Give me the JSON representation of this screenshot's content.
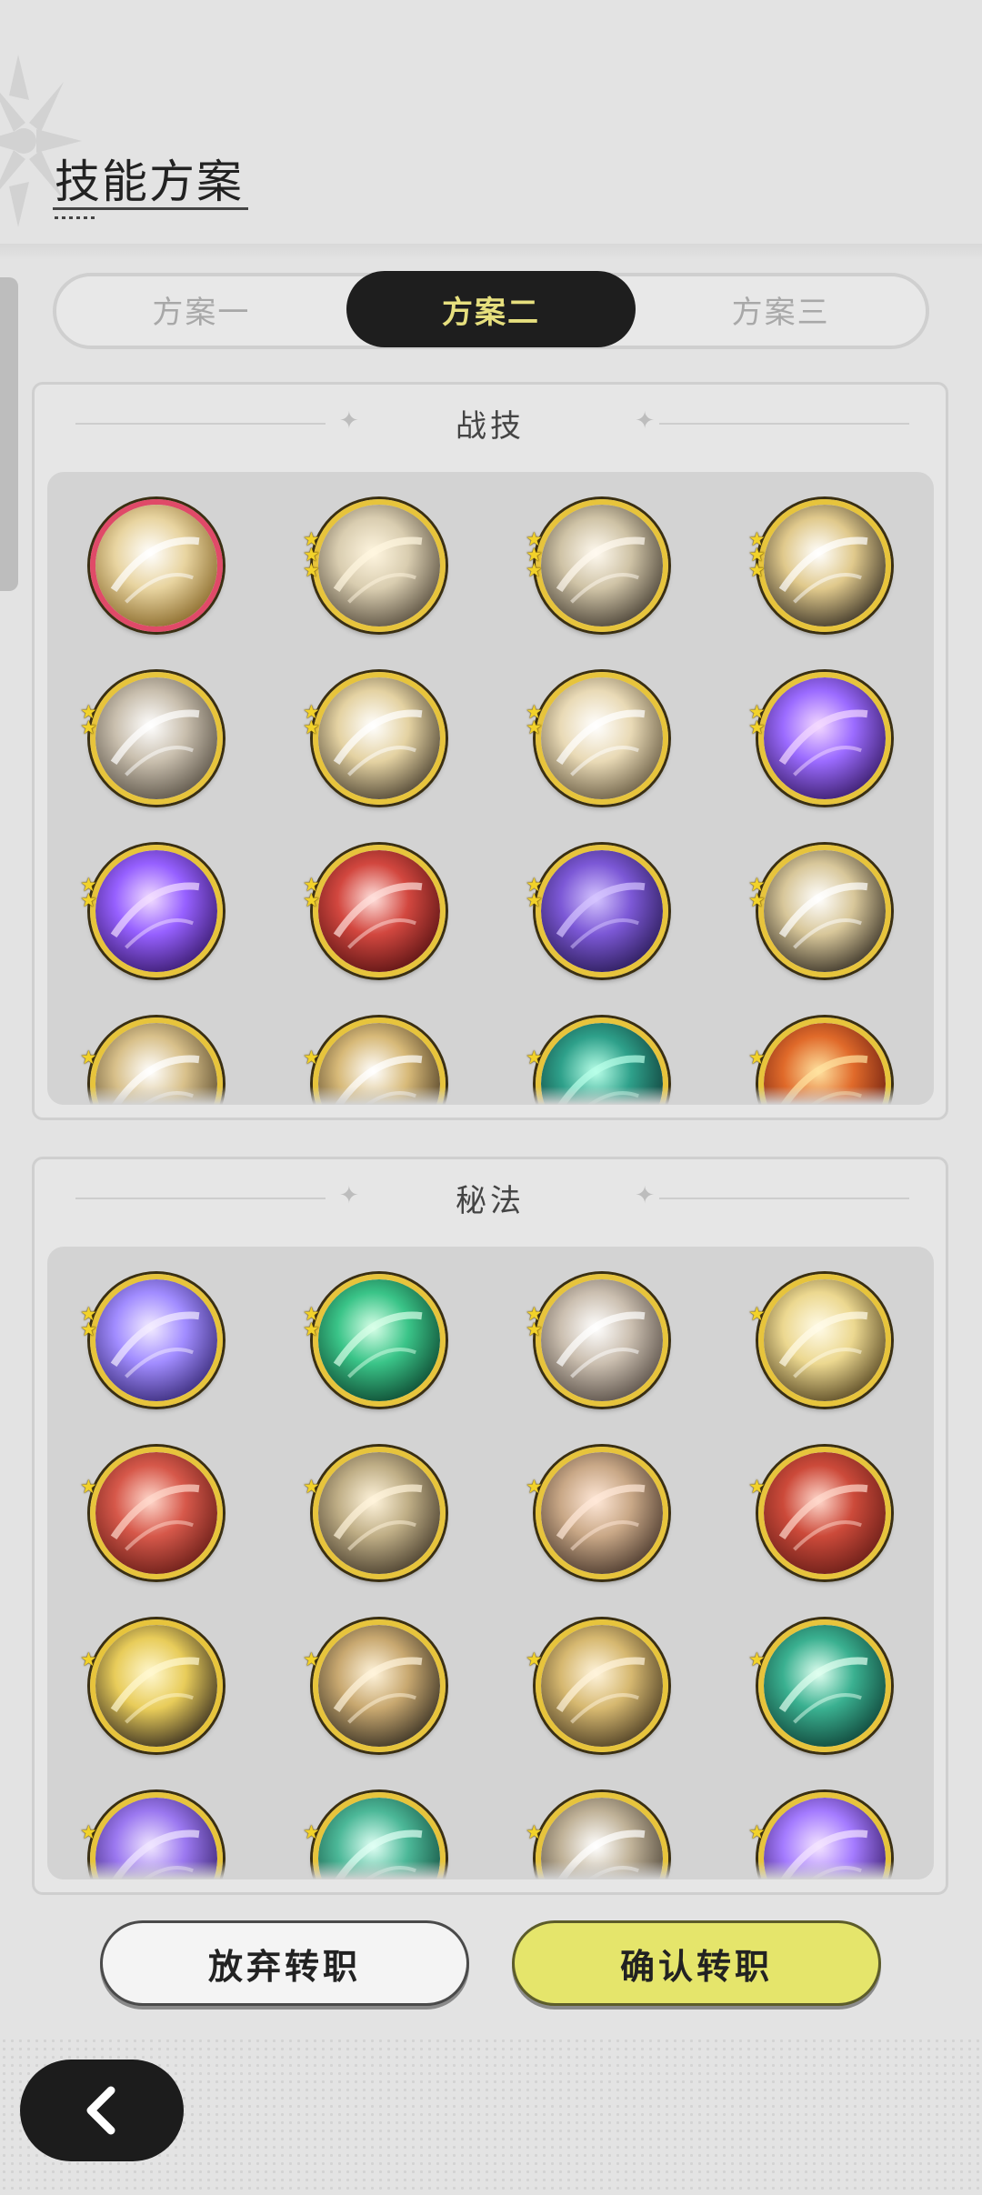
{
  "header": {
    "title": "技能方案"
  },
  "tabs": [
    {
      "label": "方案一",
      "active": false
    },
    {
      "label": "方案二",
      "active": true
    },
    {
      "label": "方案三",
      "active": false
    }
  ],
  "panels": {
    "combat": {
      "title": "战技",
      "skills": [
        {
          "icon": "golden-swirl-skill-icon",
          "stars": 0,
          "selected": true
        },
        {
          "icon": "wind-slash-skill-icon",
          "stars": 3
        },
        {
          "icon": "light-pillars-skill-icon",
          "stars": 3
        },
        {
          "icon": "blade-strike-skill-icon",
          "stars": 3
        },
        {
          "icon": "afterimage-dash-skill-icon",
          "stars": 2
        },
        {
          "icon": "sword-burst-skill-icon",
          "stars": 2
        },
        {
          "icon": "whirlwind-skill-icon",
          "stars": 2
        },
        {
          "icon": "purple-flame-skill-icon",
          "stars": 2
        },
        {
          "icon": "purple-heart-skill-icon",
          "stars": 2
        },
        {
          "icon": "red-rally-skill-icon",
          "stars": 2
        },
        {
          "icon": "shadow-claw-skill-icon",
          "stars": 2
        },
        {
          "icon": "spear-thrust-skill-icon",
          "stars": 2
        },
        {
          "icon": "golden-wave-skill-icon",
          "stars": 1
        },
        {
          "icon": "ground-spike-skill-icon",
          "stars": 1
        },
        {
          "icon": "teal-wind-skill-icon",
          "stars": 1
        },
        {
          "icon": "red-sigil-skill-icon",
          "stars": 1
        }
      ]
    },
    "secret": {
      "title": "秘法",
      "skills": [
        {
          "icon": "arcane-sigil-icon",
          "stars": 2
        },
        {
          "icon": "green-crystal-icon",
          "stars": 2
        },
        {
          "icon": "sword-upgrade-icon",
          "stars": 2
        },
        {
          "icon": "all-seeing-eye-icon",
          "stars": 1
        },
        {
          "icon": "red-armor-icon",
          "stars": 1
        },
        {
          "icon": "dragon-relic-icon",
          "stars": 1
        },
        {
          "icon": "heart-shield-icon",
          "stars": 1
        },
        {
          "icon": "red-scroll-icon",
          "stars": 1
        },
        {
          "icon": "golden-aura-icon",
          "stars": 1
        },
        {
          "icon": "vortex-compass-icon",
          "stars": 1
        },
        {
          "icon": "golden-armor-icon",
          "stars": 1
        },
        {
          "icon": "green-heart-icon",
          "stars": 1
        },
        {
          "icon": "purple-wave-icon",
          "stars": 1
        },
        {
          "icon": "green-potion-icon",
          "stars": 1
        },
        {
          "icon": "arrow-upgrade-icon",
          "stars": 1
        },
        {
          "icon": "purple-flame-icon",
          "stars": 1
        }
      ]
    }
  },
  "buttons": {
    "abandon": "放弃转职",
    "confirm": "确认转职"
  },
  "colors": {
    "accent_yellow": "#e5e56b",
    "active_tab_bg": "#1e1e1e",
    "active_tab_text": "#e6df7e",
    "medal_ring": "#e7c43c",
    "selected_ring": "#e04a68"
  }
}
